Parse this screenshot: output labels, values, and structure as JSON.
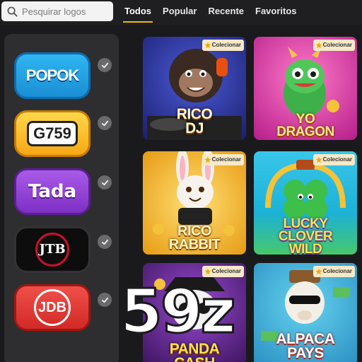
{
  "search": {
    "placeholder": "Pesquirar logos"
  },
  "tabs": [
    {
      "label": "Todos",
      "active": true
    },
    {
      "label": "Popular",
      "active": false
    },
    {
      "label": "Recente",
      "active": false
    },
    {
      "label": "Favoritos",
      "active": false
    }
  ],
  "providers": [
    {
      "label": "POPOK",
      "selected": true
    },
    {
      "label": "G759",
      "selected": true
    },
    {
      "label": "Tada",
      "selected": true
    },
    {
      "label": "JTB",
      "selected": true
    },
    {
      "label": "JDB",
      "selected": true
    }
  ],
  "games": [
    {
      "title": "RICO DJ",
      "badge": "Colecionar",
      "accent": "#1c1f6e"
    },
    {
      "title": "YO DRAGON",
      "badge": "Colecionar",
      "accent": "#b51e8a"
    },
    {
      "title": "RICO RABBIT",
      "badge": "Colecionar",
      "accent": "#e79a13"
    },
    {
      "title": "LUCKY CLOVER WILD",
      "badge": "Colecionar",
      "accent": "#1db1d6"
    },
    {
      "title": "PANDA CASH",
      "badge": "Colecionar",
      "accent": "#3b145e"
    },
    {
      "title": "ALPACA PAYS",
      "badge": "Colecionar",
      "accent": "#2a8fc3"
    }
  ],
  "watermark": "59z",
  "colors": {
    "tab_underline": "#f2b21a",
    "background": "#1a1a1c",
    "sidebar": "#2e2e31"
  }
}
